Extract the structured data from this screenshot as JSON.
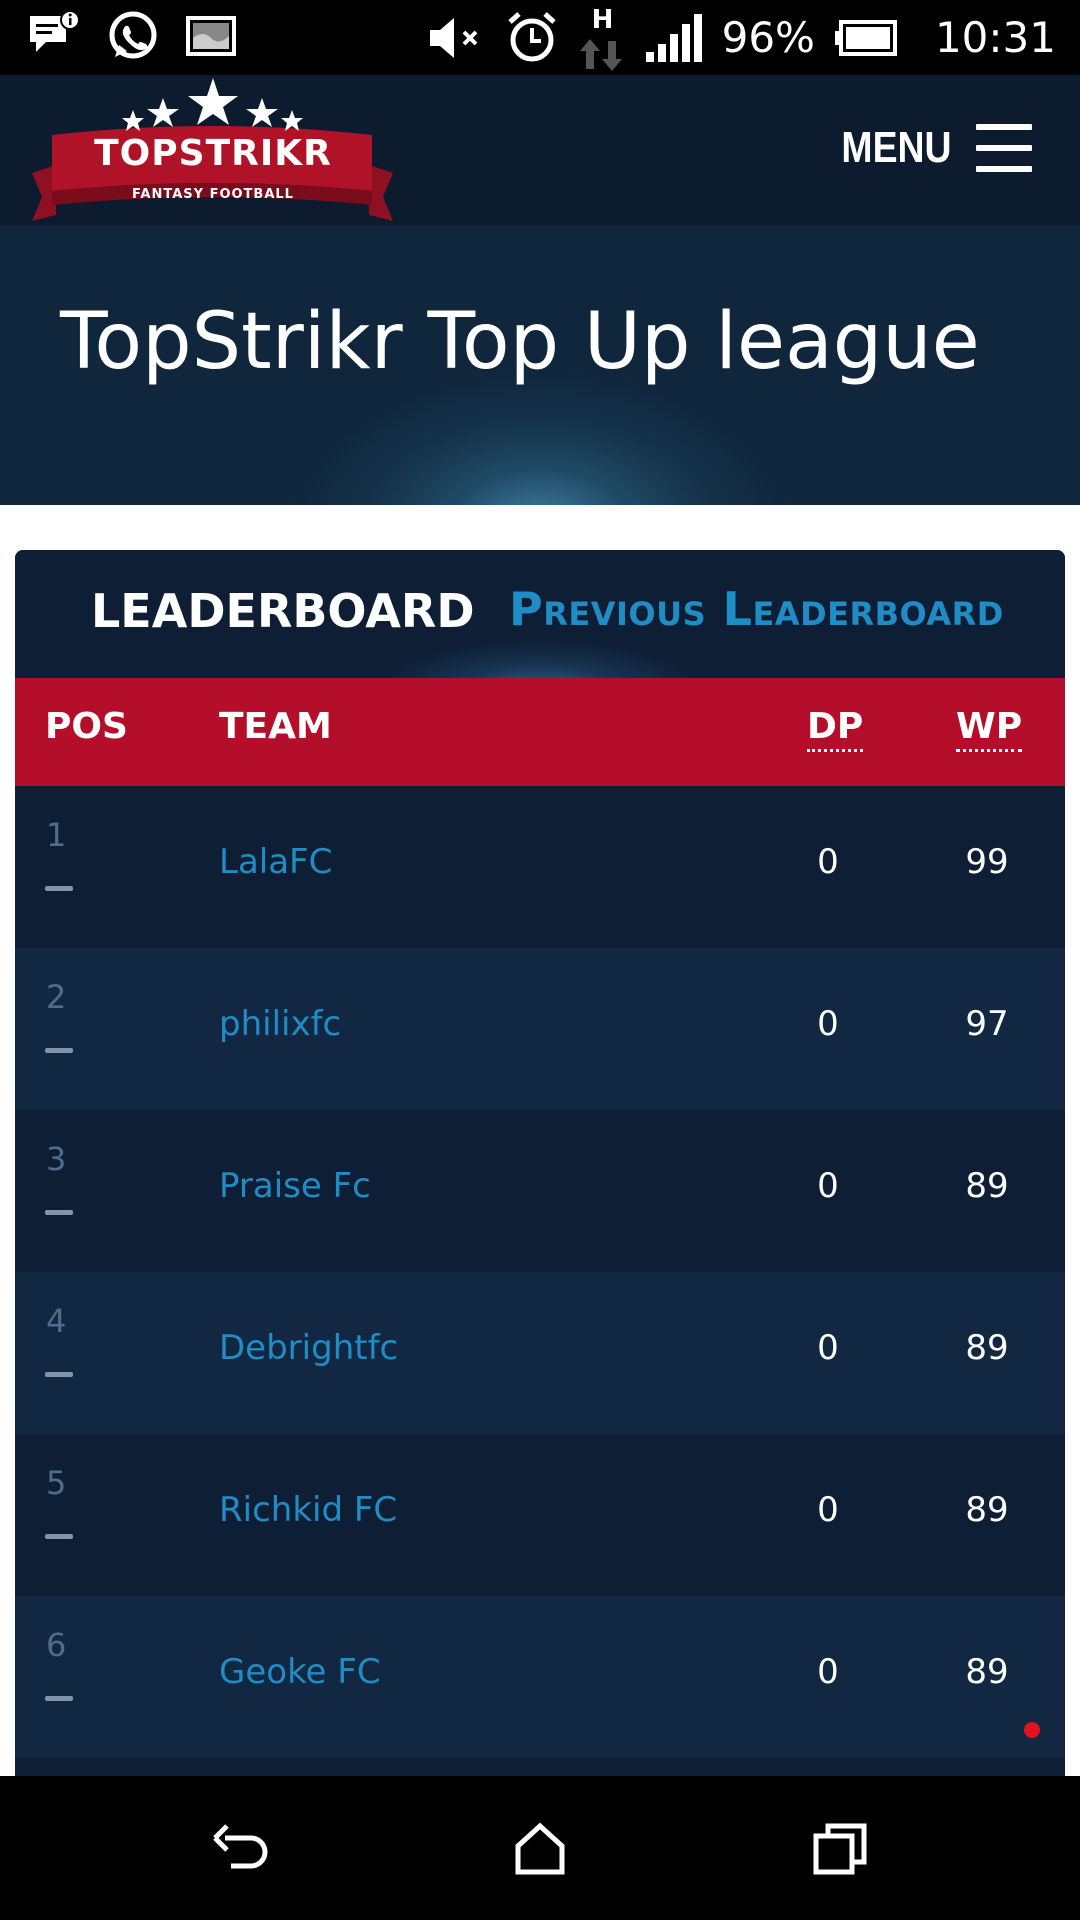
{
  "status_bar": {
    "battery_percent": "96%",
    "time": "10:31",
    "network_type": "H",
    "icons": [
      "notification-icon",
      "whatsapp-icon",
      "gallery-icon",
      "mute-icon",
      "alarm-icon",
      "data-arrows-icon",
      "signal-icon",
      "battery-icon"
    ]
  },
  "header": {
    "logo_text": "TOPSTRIKR",
    "logo_subtext": "FANTASY FOOTBALL",
    "menu_label": "MENU"
  },
  "hero": {
    "title": "TopStrikr Top Up league"
  },
  "leaderboard": {
    "tabs": {
      "active": "LEADERBOARD",
      "previous": "Previous Leaderboard"
    },
    "columns": {
      "pos": "POS",
      "team": "TEAM",
      "dp": "DP",
      "wp": "WP"
    },
    "rows": [
      {
        "pos": "1",
        "team": "LalaFC",
        "dp": "0",
        "wp": "99"
      },
      {
        "pos": "2",
        "team": "philixfc",
        "dp": "0",
        "wp": "97"
      },
      {
        "pos": "3",
        "team": "Praise Fc",
        "dp": "0",
        "wp": "89"
      },
      {
        "pos": "4",
        "team": "Debrightfc",
        "dp": "0",
        "wp": "89"
      },
      {
        "pos": "5",
        "team": "Richkid FC",
        "dp": "0",
        "wp": "89"
      },
      {
        "pos": "6",
        "team": "Geoke FC",
        "dp": "0",
        "wp": "89"
      }
    ]
  },
  "colors": {
    "header_bg": "#0c1b2e",
    "table_header_red": "#b50e2b",
    "link_blue": "#1f8cc5",
    "row_dark": "#0e1f35",
    "row_light": "#122741"
  }
}
